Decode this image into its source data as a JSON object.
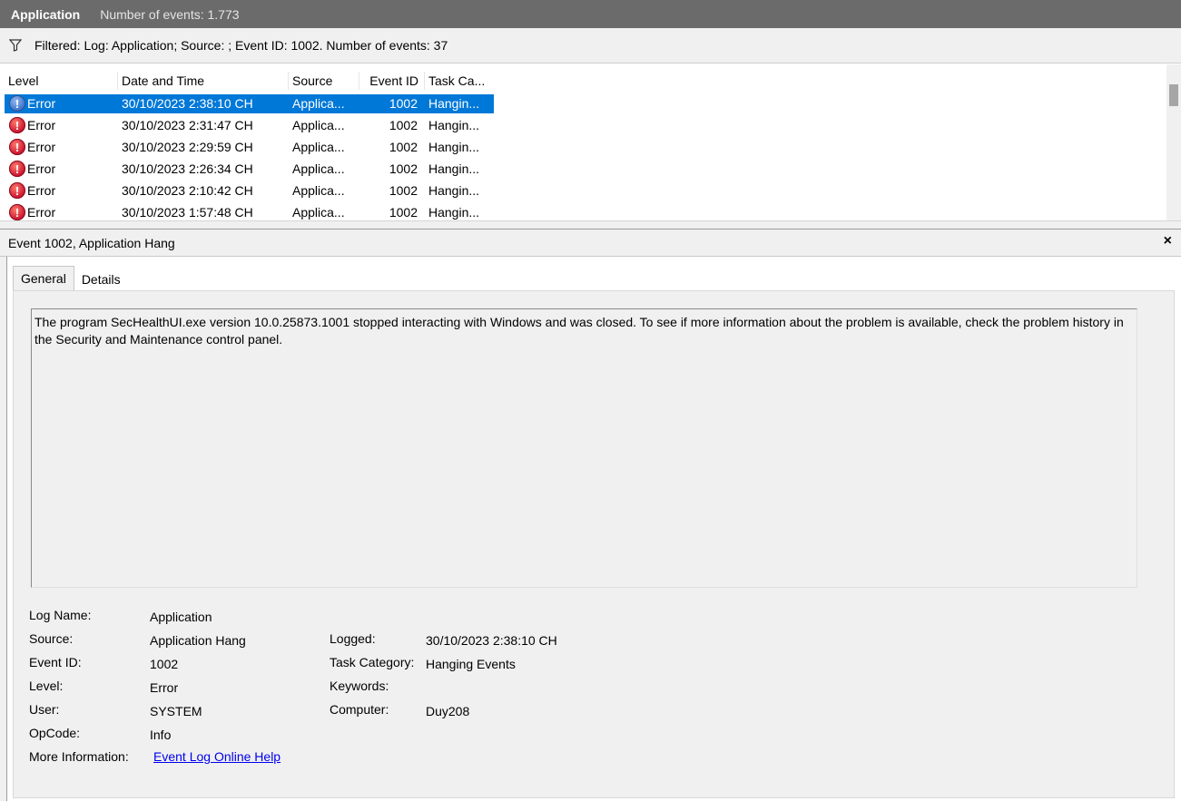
{
  "titlebar": {
    "log_name": "Application",
    "event_count": "Number of events: 1.773"
  },
  "filter": {
    "text": "Filtered: Log: Application; Source: ; Event ID: 1002. Number of events: 37",
    "icon": "filter-icon"
  },
  "grid": {
    "columns": [
      "Level",
      "Date and Time",
      "Source",
      "Event ID",
      "Task Ca..."
    ],
    "rows": [
      {
        "level": "Error",
        "date": "30/10/2023 2:38:10 CH",
        "source": "Applica...",
        "event_id": "1002",
        "task": "Hangin...",
        "selected": true
      },
      {
        "level": "Error",
        "date": "30/10/2023 2:31:47 CH",
        "source": "Applica...",
        "event_id": "1002",
        "task": "Hangin..."
      },
      {
        "level": "Error",
        "date": "30/10/2023 2:29:59 CH",
        "source": "Applica...",
        "event_id": "1002",
        "task": "Hangin..."
      },
      {
        "level": "Error",
        "date": "30/10/2023 2:26:34 CH",
        "source": "Applica...",
        "event_id": "1002",
        "task": "Hangin..."
      },
      {
        "level": "Error",
        "date": "30/10/2023 2:10:42 CH",
        "source": "Applica...",
        "event_id": "1002",
        "task": "Hangin..."
      },
      {
        "level": "Error",
        "date": "30/10/2023 1:57:48 CH",
        "source": "Applica...",
        "event_id": "1002",
        "task": "Hangin..."
      }
    ]
  },
  "detail": {
    "title": "Event 1002, Application Hang",
    "close": "×",
    "tabs": [
      "General",
      "Details"
    ],
    "description": "The program SecHealthUI.exe version 10.0.25873.1001 stopped interacting with Windows and was closed. To see if more information about the problem is available, check the problem history in the Security and Maintenance control panel.",
    "fields": {
      "log_name_label": "Log Name:",
      "log_name": "Application",
      "source_label": "Source:",
      "source": "Application Hang",
      "logged_label": "Logged:",
      "logged": "30/10/2023 2:38:10 CH",
      "event_id_label": "Event ID:",
      "event_id": "1002",
      "task_category_label": "Task Category:",
      "task_category": "Hanging Events",
      "level_label": "Level:",
      "level": "Error",
      "keywords_label": "Keywords:",
      "keywords": "",
      "user_label": "User:",
      "user": "SYSTEM",
      "computer_label": "Computer:",
      "computer": "Duy208",
      "opcode_label": "OpCode:",
      "opcode": "Info",
      "more_info_label": "More Information:",
      "more_info_link": "Event Log Online Help"
    }
  }
}
